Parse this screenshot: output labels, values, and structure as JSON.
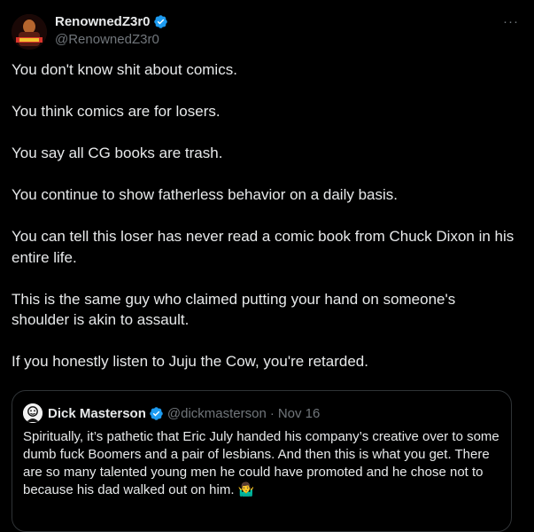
{
  "colors": {
    "background": "#000000",
    "text_primary": "#e7e9ea",
    "text_secondary": "#71767b",
    "verified_blue": "#1d9bf0",
    "border": "#2f3336"
  },
  "tweet": {
    "author": {
      "display_name": "RenownedZ3r0",
      "handle": "@RenownedZ3r0",
      "verified": true,
      "avatar_icon": "avatar-image"
    },
    "more_label": "···",
    "paragraphs": [
      "You don't know shit about comics.",
      "You think comics are for losers.",
      "You say all CG books are trash.",
      "You continue to show fatherless behavior on a daily basis.",
      "You can tell this loser has never read a comic book from Chuck Dixon in his entire life.",
      "This is the same guy who claimed putting your hand on someone's shoulder is akin to assault.",
      "If you honestly listen to Juju the Cow, you're retarded."
    ],
    "quoted_tweet": {
      "display_name": "Dick Masterson",
      "handle": "@dickmasterson",
      "separator": "·",
      "date": "Nov 16",
      "verified": true,
      "text": "Spiritually, it’s pathetic that Eric July handed his company’s creative over to some dumb fuck Boomers and a pair of lesbians. And then this is what you get. There are so many talented young men he could have promoted and he chose not to because his dad walked out on him. 🤷‍♂️"
    }
  }
}
